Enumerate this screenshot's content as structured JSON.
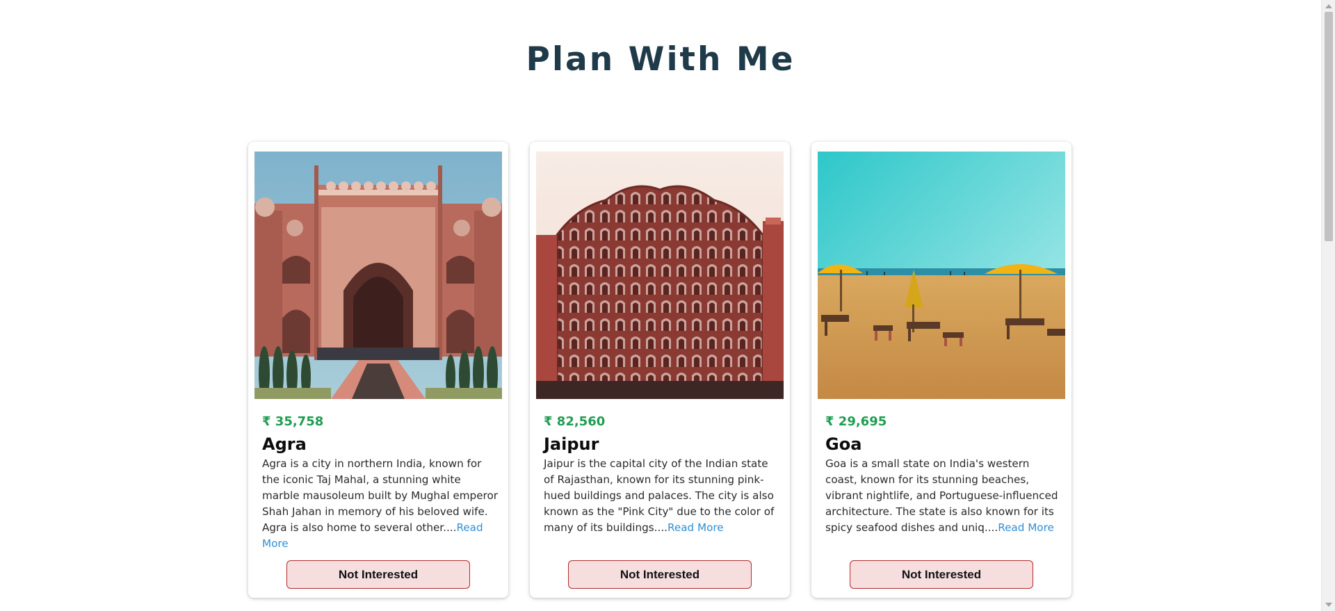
{
  "page": {
    "title": "Plan With Me"
  },
  "cards": [
    {
      "price": "₹ 35,758",
      "name": "Agra",
      "description": "Agra is a city in northern India, known for the iconic Taj Mahal, a stunning white marble mausoleum built by Mughal emperor Shah Jahan in memory of his beloved wife. Agra is also home to several other....",
      "read_more": "Read More",
      "button": "Not Interested",
      "image_icon": "mughal-gateway-image"
    },
    {
      "price": "₹ 82,560",
      "name": "Jaipur",
      "description": "Jaipur is the capital city of the Indian state of Rajasthan, known for its stunning pink-hued buildings and palaces. The city is also known as the \"Pink City\" due to the color of many of its buildings....",
      "read_more": "Read More",
      "button": "Not Interested",
      "image_icon": "hawa-mahal-image"
    },
    {
      "price": "₹ 29,695",
      "name": "Goa",
      "description": "Goa is a small state on India's western coast, known for its stunning beaches, vibrant nightlife, and Portuguese-influenced architecture. The state is also known for its spicy seafood dishes and uniq....",
      "read_more": "Read More",
      "button": "Not Interested",
      "image_icon": "beach-image"
    }
  ],
  "colors": {
    "title": "#1f3a48",
    "price": "#1e9d52",
    "link": "#2f8fd3",
    "button_bg": "#f6dede",
    "button_border": "#b32a2a"
  }
}
